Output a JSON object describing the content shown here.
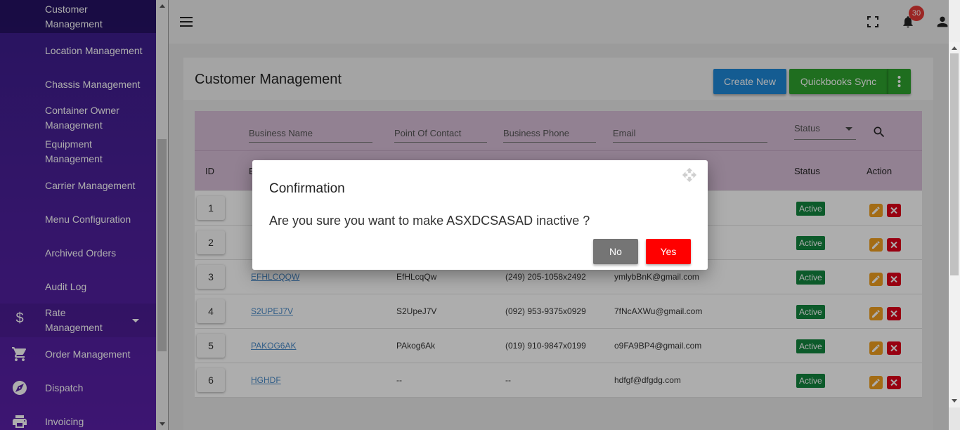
{
  "sidebar": {
    "items": [
      {
        "label": "Customer\nManagement"
      },
      {
        "label": "Location Management"
      },
      {
        "label": "Chassis Management"
      },
      {
        "label": "Container Owner Management"
      },
      {
        "label": "Equipment Management"
      },
      {
        "label": "Carrier Management"
      },
      {
        "label": "Menu Configuration"
      },
      {
        "label": "Archived Orders"
      },
      {
        "label": "Audit Log"
      },
      {
        "label": "Rate Management",
        "icon": "dollar-icon"
      },
      {
        "label": "Order Management",
        "icon": "cart-icon"
      },
      {
        "label": "Dispatch",
        "icon": "compass-icon"
      },
      {
        "label": "Invoicing",
        "icon": "printer-icon"
      }
    ]
  },
  "header": {
    "notification_count": "30",
    "icons": [
      "menu-icon",
      "fullscreen-icon",
      "bell-icon",
      "account-icon"
    ]
  },
  "page": {
    "title": "Customer Management",
    "create_label": "Create New",
    "sync_label": "Quickbooks Sync"
  },
  "filters": {
    "business_name": "Business Name",
    "point_of_contact": "Point Of Contact",
    "business_phone": "Business Phone",
    "email": "Email",
    "status": "Status"
  },
  "table": {
    "headers": {
      "id": "ID",
      "business": "B",
      "status": "Status",
      "action": "Action"
    },
    "rows": [
      {
        "id": "1",
        "business": "",
        "contact": "",
        "phone": "",
        "email": "",
        "status": "Active"
      },
      {
        "id": "2",
        "business": "",
        "contact": "",
        "phone": "",
        "email": "",
        "status": "Active"
      },
      {
        "id": "3",
        "business": "EFHLCQQW",
        "contact": "EfHLcqQw",
        "phone": "(249) 205-1058x2492",
        "email": "ymlybBnK@gmail.com",
        "status": "Active"
      },
      {
        "id": "4",
        "business": "S2UPEJ7V",
        "contact": "S2UpeJ7V",
        "phone": "(092) 953-9375x0929",
        "email": "7fNcAXWu@gmail.com",
        "status": "Active"
      },
      {
        "id": "5",
        "business": "PAKOG6AK",
        "contact": "PAkog6Ak",
        "phone": "(019) 910-9847x0199",
        "email": "o9FA9BP4@gmail.com",
        "status": "Active"
      },
      {
        "id": "6",
        "business": "HGHDF",
        "contact": "--",
        "phone": "--",
        "email": "hdfgf@dfgdg.com",
        "status": "Active"
      }
    ]
  },
  "dialog": {
    "title": "Confirmation",
    "message": "Are you sure you want to make ASXDCSASAD inactive ?",
    "no_label": "No",
    "yes_label": "Yes"
  },
  "colors": {
    "sidebar": "#4a1f99",
    "primary": "#1e88d8",
    "success": "#2ea32e",
    "danger": "#ff0000",
    "status_active": "#12853f",
    "table_header": "#d8bfd8"
  }
}
